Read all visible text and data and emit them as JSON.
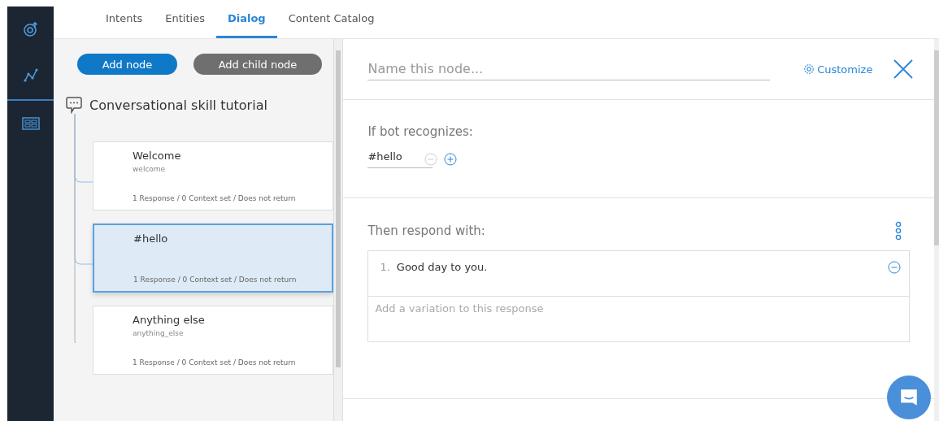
{
  "tabs": [
    {
      "label": "Intents",
      "selected": false
    },
    {
      "label": "Entities",
      "selected": false
    },
    {
      "label": "Dialog",
      "selected": true
    },
    {
      "label": "Content Catalog",
      "selected": false
    }
  ],
  "toolbar": {
    "add_node": "Add node",
    "add_child_node": "Add child node"
  },
  "tree": {
    "title": "Conversational skill tutorial",
    "nodes": [
      {
        "title": "Welcome",
        "condition": "welcome",
        "summary": "1 Response / 0 Context set / Does not return",
        "selected": false
      },
      {
        "title": "#hello",
        "summary": "1 Response / 0 Context set / Does not return",
        "selected": true
      },
      {
        "title": "Anything else",
        "condition": "anything_else",
        "summary": "1 Response / 0 Context set / Does not return",
        "selected": false
      }
    ]
  },
  "editor": {
    "name_placeholder": "Name this node...",
    "customize": "Customize",
    "condition_label": "If bot recognizes:",
    "condition_value": "#hello",
    "response_label": "Then respond with:",
    "responses": [
      {
        "number": "1.",
        "text": "Good day to you."
      }
    ],
    "variation_placeholder": "Add a variation to this response"
  }
}
